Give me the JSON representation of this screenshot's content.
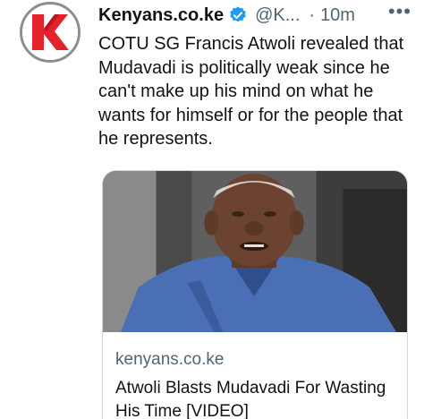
{
  "tweet": {
    "display_name": "Kenyans.co.ke",
    "handle": "@K...",
    "separator": "·",
    "time": "10m",
    "more_label": "•••",
    "text": "COTU SG Francis Atwoli revealed that Mudavadi is politically weak since he can't make up his mind on what he wants for himself or for the people that he represents.",
    "avatar_icon": "kenyans-logo-icon",
    "verified_icon": "verified-badge-icon",
    "colors": {
      "verified": "#1d9bf0",
      "brand_red": "#e3232b",
      "secondary_text": "#536471"
    }
  },
  "card": {
    "domain": "kenyans.co.ke",
    "title": "Atwoli Blasts Mudavadi For Wasting His Time [VIDEO]"
  }
}
